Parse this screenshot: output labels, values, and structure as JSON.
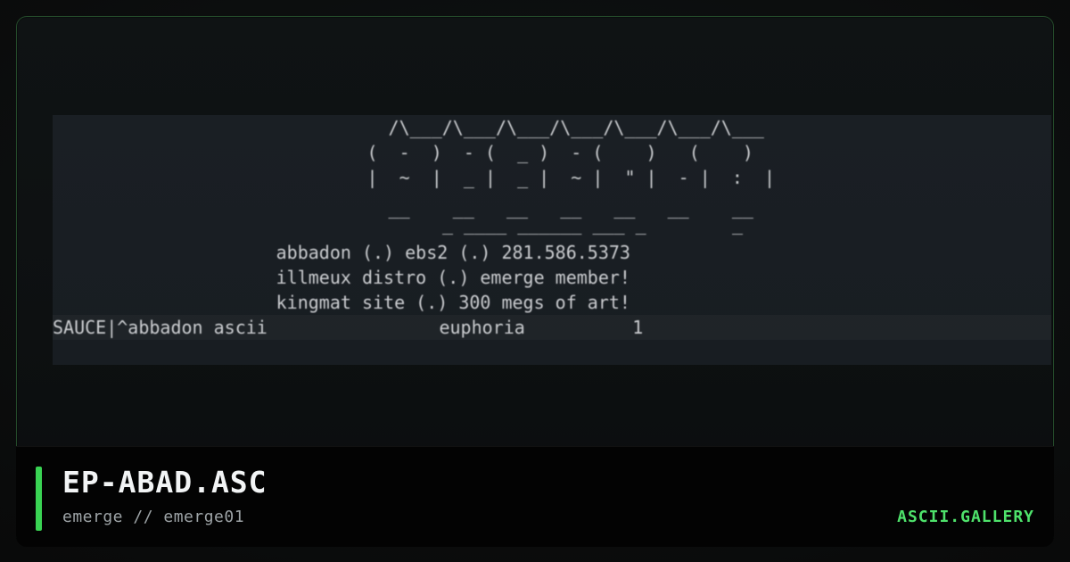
{
  "artwork": {
    "ascii_lines": [
      "             /\\___/\\___/\\___/\\___/\\___/\\___/\\___",
      "            (  -  )  - (  _ )  - (    )   (    )",
      "            |  ~  |  _ |  _ |  ~ |  \" |  - |  :  |",
      "             __    __   __   __   __   __    __",
      "                       _ ____ ______ ___ _        _",
      "               abbadon (.) ebs2 (.) 281.586.5373",
      "               illmeux distro (.) emerge member!",
      "               kingmat site (.) 300 megs of art!",
      "SAUCE|^abbadon ascii                euphoria          1"
    ]
  },
  "caption": {
    "title": "EP-ABAD.ASC",
    "subtitle": "emerge // emerge01",
    "brand": "ASCII.GALLERY"
  },
  "colors": {
    "accent": "#39d353",
    "brand": "#4ee26b",
    "preview_background": "#1a1f24",
    "frame_border": "#244a2a"
  }
}
